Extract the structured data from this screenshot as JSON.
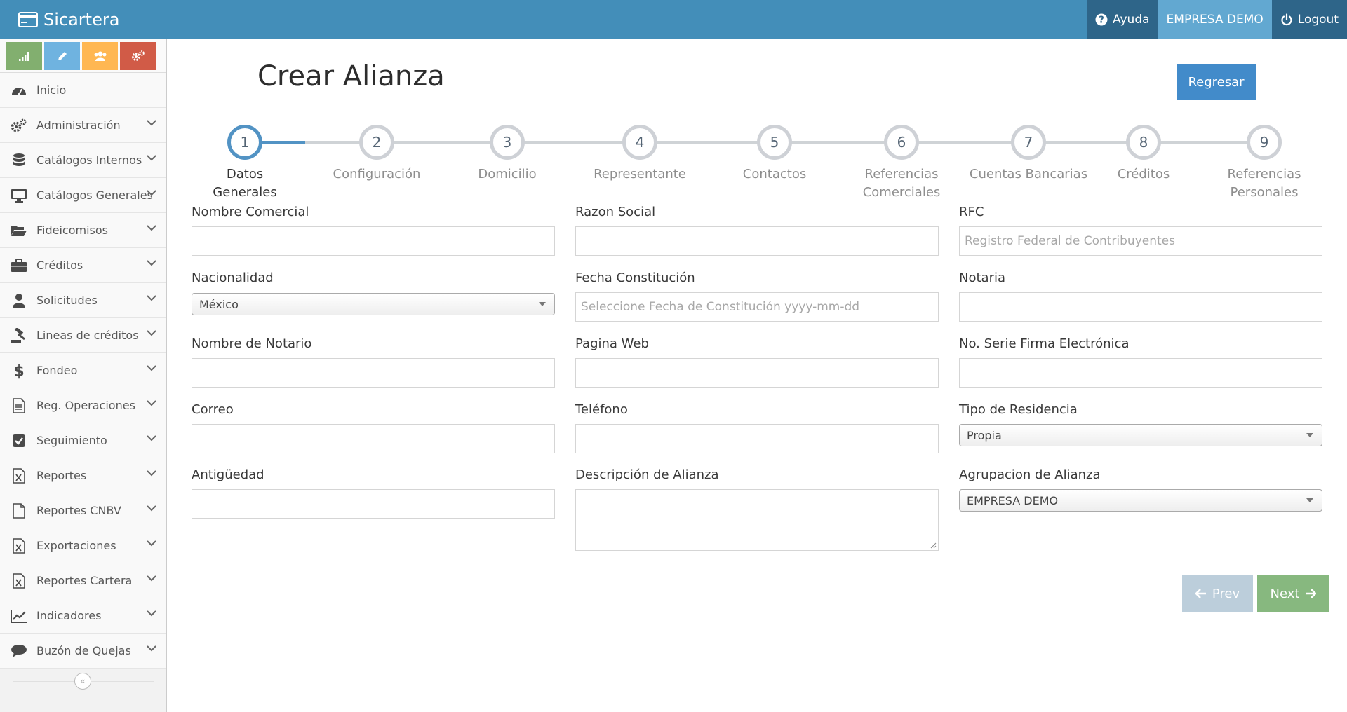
{
  "navbar": {
    "brand": "Sicartera",
    "help": "Ayuda",
    "company": "EMPRESA DEMO",
    "logout": "Logout"
  },
  "sidebar": {
    "items": [
      {
        "label": "Inicio",
        "icon": "dashboard-icon"
      },
      {
        "label": "Administración",
        "icon": "cogs-icon"
      },
      {
        "label": "Catálogos Internos",
        "icon": "database-icon"
      },
      {
        "label": "Catálogos Generales",
        "icon": "desktop-icon"
      },
      {
        "label": "Fideicomisos",
        "icon": "folder-open-icon"
      },
      {
        "label": "Créditos",
        "icon": "briefcase-icon"
      },
      {
        "label": "Solicitudes",
        "icon": "user-icon"
      },
      {
        "label": "Lineas de créditos",
        "icon": "legal-icon"
      },
      {
        "label": "Fondeo",
        "icon": "dollar-icon"
      },
      {
        "label": "Reg. Operaciones",
        "icon": "file-text-icon"
      },
      {
        "label": "Seguimiento",
        "icon": "check-square-icon"
      },
      {
        "label": "Reportes",
        "icon": "file-excel-icon"
      },
      {
        "label": "Reportes CNBV",
        "icon": "file-icon"
      },
      {
        "label": "Exportaciones",
        "icon": "file-excel-icon"
      },
      {
        "label": "Reportes Cartera",
        "icon": "file-excel-icon"
      },
      {
        "label": "Indicadores",
        "icon": "line-chart-icon"
      },
      {
        "label": "Buzón de Quejas",
        "icon": "comment-icon"
      }
    ],
    "shortcut_colors": [
      "#82af6f",
      "#6fb3e0",
      "#ffb752",
      "#d15b47"
    ]
  },
  "page": {
    "title": "Crear Alianza",
    "back_button": "Regresar"
  },
  "wizard": {
    "current_step": 1,
    "steps": [
      {
        "num": "1",
        "title": "Datos Generales"
      },
      {
        "num": "2",
        "title": "Configuración"
      },
      {
        "num": "3",
        "title": "Domicilio"
      },
      {
        "num": "4",
        "title": "Representante"
      },
      {
        "num": "5",
        "title": "Contactos"
      },
      {
        "num": "6",
        "title": "Referencias Comerciales"
      },
      {
        "num": "7",
        "title": "Cuentas Bancarias"
      },
      {
        "num": "8",
        "title": "Créditos"
      },
      {
        "num": "9",
        "title": "Referencias Personales"
      }
    ]
  },
  "form": {
    "nombre_comercial": {
      "label": "Nombre Comercial",
      "value": ""
    },
    "razon_social": {
      "label": "Razon Social",
      "value": ""
    },
    "rfc": {
      "label": "RFC",
      "placeholder": "Registro Federal de Contribuyentes"
    },
    "nacionalidad": {
      "label": "Nacionalidad",
      "value": "México"
    },
    "fecha_constitucion": {
      "label": "Fecha Constitución",
      "placeholder": "Seleccione Fecha de Constitución yyyy-mm-dd"
    },
    "notaria": {
      "label": "Notaria",
      "value": ""
    },
    "nombre_notario": {
      "label": "Nombre de Notario",
      "value": ""
    },
    "pagina_web": {
      "label": "Pagina Web",
      "value": ""
    },
    "no_serie_firma": {
      "label": "No. Serie Firma Electrónica",
      "value": ""
    },
    "correo": {
      "label": "Correo",
      "value": ""
    },
    "telefono": {
      "label": "Teléfono",
      "value": ""
    },
    "tipo_residencia": {
      "label": "Tipo de Residencia",
      "value": "Propia"
    },
    "antiguedad": {
      "label": "Antigüedad",
      "value": ""
    },
    "descripcion": {
      "label": "Descripción de Alianza",
      "value": ""
    },
    "agrupacion": {
      "label": "Agrupacion de Alianza",
      "value": "EMPRESA DEMO"
    }
  },
  "buttons": {
    "prev": "Prev",
    "next": "Next"
  }
}
